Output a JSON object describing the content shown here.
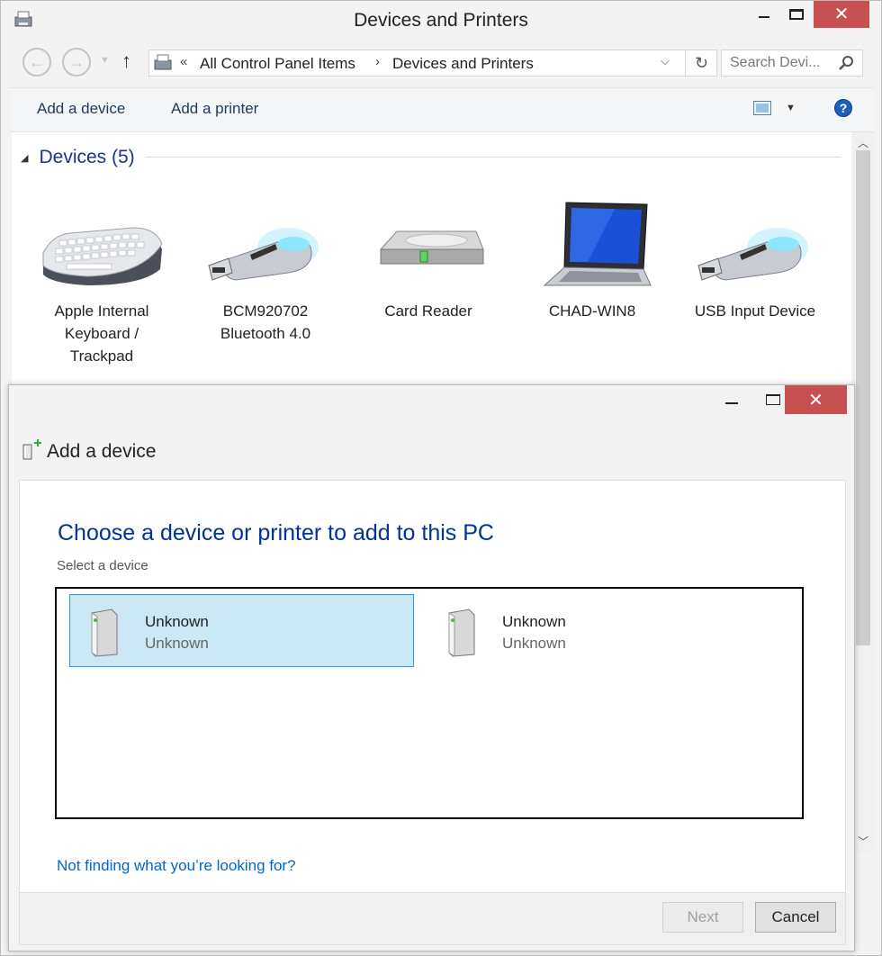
{
  "window": {
    "title": "Devices and Printers",
    "close_glyph": "✕"
  },
  "address": {
    "back_icon": "←",
    "forward_icon": "→",
    "up_icon": "↑",
    "chevron": "«",
    "crumbs": [
      "All Control Panel Items",
      "Devices and Printers"
    ],
    "separator": "›",
    "refresh_icon": "↻",
    "search_placeholder": "Search Devi..."
  },
  "commands": {
    "add_device": "Add a device",
    "add_printer": "Add a printer",
    "help": "?"
  },
  "devices": {
    "header": "Devices (5)",
    "items": [
      {
        "label": "Apple Internal Keyboard / Trackpad",
        "icon": "keyboard-icon"
      },
      {
        "label": "BCM920702 Bluetooth 4.0",
        "icon": "usb-dongle-icon"
      },
      {
        "label": "Card Reader",
        "icon": "drive-icon"
      },
      {
        "label": "CHAD-WIN8",
        "icon": "laptop-icon"
      },
      {
        "label": "USB Input Device",
        "icon": "usb-dongle-icon"
      }
    ]
  },
  "dialog": {
    "title": "Add a device",
    "heading": "Choose a device or printer to add to this PC",
    "subheading": "Select a device",
    "devices": [
      {
        "name": "Unknown",
        "type": "Unknown",
        "selected": true
      },
      {
        "name": "Unknown",
        "type": "Unknown",
        "selected": false
      }
    ],
    "not_finding": "Not finding what you’re looking for?",
    "next_label": "Next",
    "cancel_label": "Cancel",
    "close_glyph": "✕"
  },
  "colors": {
    "accent": "#26a0da",
    "selection": "#cce8f4",
    "heading": "#003399",
    "link": "#0066cc",
    "close": "#c75050"
  }
}
